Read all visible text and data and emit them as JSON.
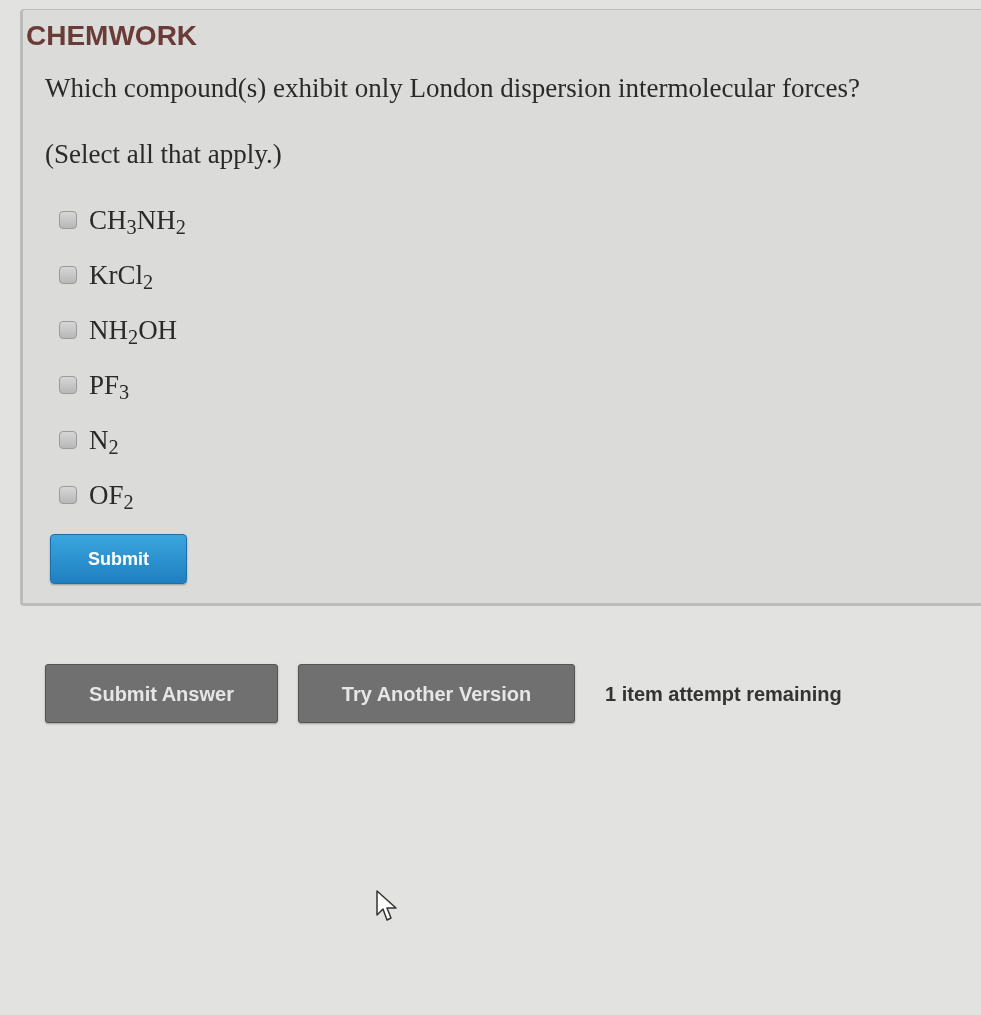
{
  "header": {
    "title": "CHEMWORK"
  },
  "question": {
    "prompt": "Which compound(s) exhibit only London dispersion intermolecular forces?",
    "instruction": "(Select all that apply.)"
  },
  "options": [
    {
      "label": "CH$_{3}$NH$_{2}$",
      "checked": false
    },
    {
      "label": "KrCl$_{2}$",
      "checked": false
    },
    {
      "label": "NH$_{2}$OH",
      "checked": false
    },
    {
      "label": "PF$_{3}$",
      "checked": false
    },
    {
      "label": "N$_{2}$",
      "checked": false
    },
    {
      "label": "OF$_{2}$",
      "checked": false
    }
  ],
  "submit_button": "Submit",
  "actions": {
    "buttons": [
      "Submit Answer",
      "Try Another Version"
    ],
    "attempts": "1 item attempt remaining"
  }
}
